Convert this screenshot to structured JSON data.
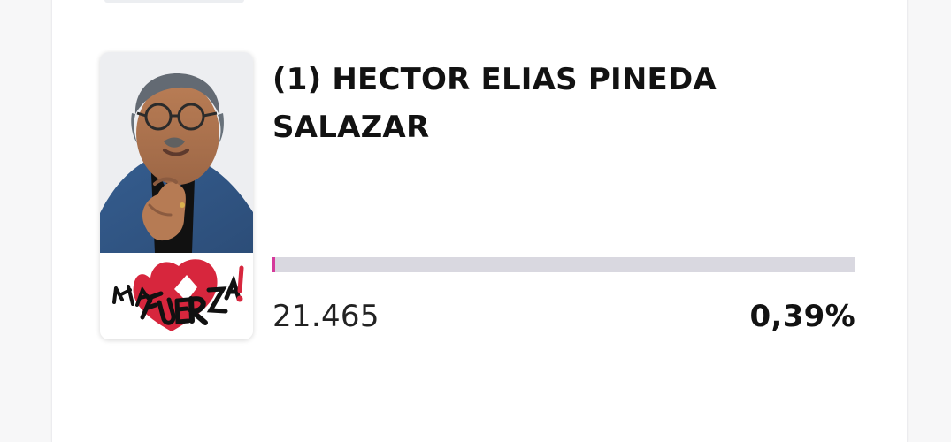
{
  "candidate": {
    "name": "(1) HECTOR ELIAS PINEDA SALAZAR",
    "votes": "21.465",
    "percent": "0,39%",
    "vote_share": 0.0039,
    "bar_color": "#d53a9b",
    "track_color": "#d9d8e0"
  },
  "party": {
    "logo_text": "LA FUERZA!",
    "accent_color": "#d7263d"
  }
}
